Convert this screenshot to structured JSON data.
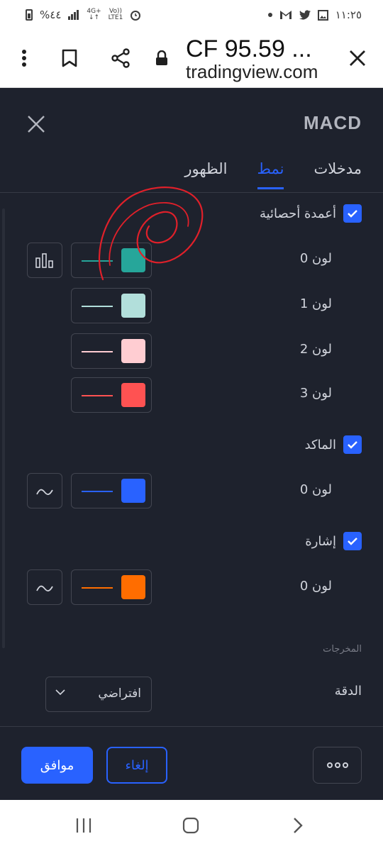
{
  "status_bar": {
    "battery_text": "%٤٤",
    "network_top": "4G+",
    "network_bottom": "LTE1",
    "volte_top": "Vo))",
    "time": "١١:٢٥"
  },
  "browser": {
    "title": "CF 95.59 ...",
    "url": "tradingview.com",
    "menu_icon": "more-vert-icon",
    "bookmark_icon": "bookmark-icon",
    "share_icon": "share-icon",
    "lock_icon": "lock-icon",
    "close_icon": "close-icon"
  },
  "dialog": {
    "title": "MACD",
    "tabs": [
      {
        "label": "مدخلات",
        "active": false
      },
      {
        "label": "نمط",
        "active": true
      },
      {
        "label": "الظهور",
        "active": false
      }
    ],
    "sections": {
      "histogram": {
        "label": "أعمدة أحصائية",
        "checked": true,
        "colors": [
          {
            "label": "لون 0",
            "color": "#26a69a"
          },
          {
            "label": "لون 1",
            "color": "#b2dfdb"
          },
          {
            "label": "لون 2",
            "color": "#ffcdd2"
          },
          {
            "label": "لون 3",
            "color": "#ff5252"
          }
        ]
      },
      "macd": {
        "label": "الماكد",
        "checked": true,
        "color_label": "لون 0",
        "color": "#2962ff"
      },
      "signal": {
        "label": "إشارة",
        "checked": true,
        "color_label": "لون 0",
        "color": "#ff6d00"
      }
    },
    "outputs_caption": "المخرجات",
    "precision": {
      "label": "الدقة",
      "value": "افتراضي"
    },
    "buttons": {
      "ok": "موافق",
      "cancel": "إلغاء"
    }
  },
  "colors": {
    "background": "#1e222d",
    "accent": "#2962ff",
    "annotation": "#e0202a"
  }
}
